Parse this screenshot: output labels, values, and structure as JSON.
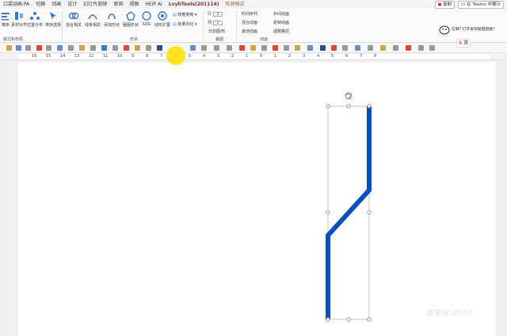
{
  "tabs": [
    {
      "label": "口袋动画 PA",
      "active": false
    },
    {
      "label": "切换",
      "active": false
    },
    {
      "label": "动画",
      "active": false
    },
    {
      "label": "设计",
      "active": false
    },
    {
      "label": "幻灯片放映",
      "active": false
    },
    {
      "label": "审阅",
      "active": false
    },
    {
      "label": "视图",
      "active": false
    },
    {
      "label": "HEIP AI",
      "active": false
    },
    {
      "label": "LvyhTools(201114)",
      "active": true
    },
    {
      "label": "形状格式",
      "active": false,
      "accent": true
    }
  ],
  "top_right": {
    "record": "录制",
    "teams": "在 Teams 中展示"
  },
  "ribbon": {
    "buttons": [
      "离序",
      "素材对齐",
      "位置分布",
      "排序选择",
      "混合相关",
      "线条相关",
      "添加形状",
      "圈图形状",
      "SVG",
      "线形扩展"
    ],
    "mini_buttons": [
      "随着复制",
      "批量内化"
    ],
    "row_label": "行",
    "col_label": "列",
    "row_value": "2",
    "col_value": "2",
    "split_label": "分割图/形",
    "anim_buttons": [
      "时间序列",
      "混合动画",
      "其他动画"
    ],
    "anim_buttons2": [
      "补间动画",
      "逐帧动画",
      "函数路径"
    ],
    "group_labels": [
      "版式和布局",
      "形状",
      "裁图",
      "动画"
    ],
    "mascot_text": "在哪? 打字发现解困困难?",
    "ime_label": "英"
  },
  "ruler_numbers": [
    "16",
    "15",
    "14",
    "13",
    "12",
    "11",
    "10",
    "9",
    "8",
    "7",
    "6",
    "5",
    "4",
    "3",
    "2",
    "1",
    "0",
    "1",
    "2",
    "3",
    "4",
    "5",
    "6",
    "7",
    "8"
  ],
  "watermark": "图表学习PPT",
  "colors": {
    "line": "#0a4fbf",
    "accent": "#8a2b2b"
  }
}
